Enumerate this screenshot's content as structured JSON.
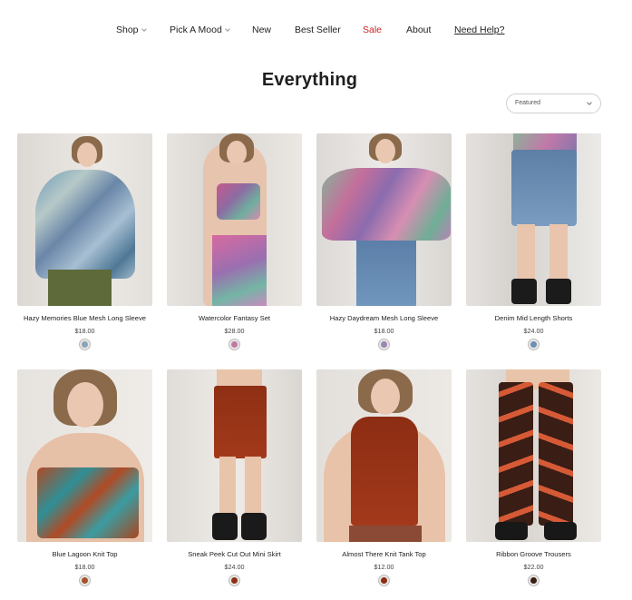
{
  "nav": {
    "items": [
      {
        "label": "Shop",
        "dropdown": true
      },
      {
        "label": "Pick A Mood",
        "dropdown": true
      },
      {
        "label": "New",
        "dropdown": false
      },
      {
        "label": "Best Seller",
        "dropdown": false
      },
      {
        "label": "Sale",
        "dropdown": false
      },
      {
        "label": "About",
        "dropdown": false
      },
      {
        "label": "Need Help?",
        "dropdown": false
      }
    ]
  },
  "page": {
    "title": "Everything"
  },
  "sort": {
    "selected": "Featured"
  },
  "products": [
    {
      "name": "Hazy Memories Blue Mesh Long Sleeve",
      "price": "$18.00"
    },
    {
      "name": "Watercolor Fantasy Set",
      "price": "$28.00"
    },
    {
      "name": "Hazy Daydream Mesh Long Sleeve",
      "price": "$18.00"
    },
    {
      "name": "Denim Mid Length Shorts",
      "price": "$24.00"
    },
    {
      "name": "Blue Lagoon Knit Top",
      "price": "$18.00"
    },
    {
      "name": "Sneak Peek Cut Out Mini Skirt",
      "price": "$24.00"
    },
    {
      "name": "Almost There Knit Tank Top",
      "price": "$12.00"
    },
    {
      "name": "Ribbon Groove Trousers",
      "price": "$22.00"
    }
  ],
  "colors": {
    "sale": "#cc1f1f",
    "text": "#222222",
    "photo_bg": "#e6e4e1"
  }
}
